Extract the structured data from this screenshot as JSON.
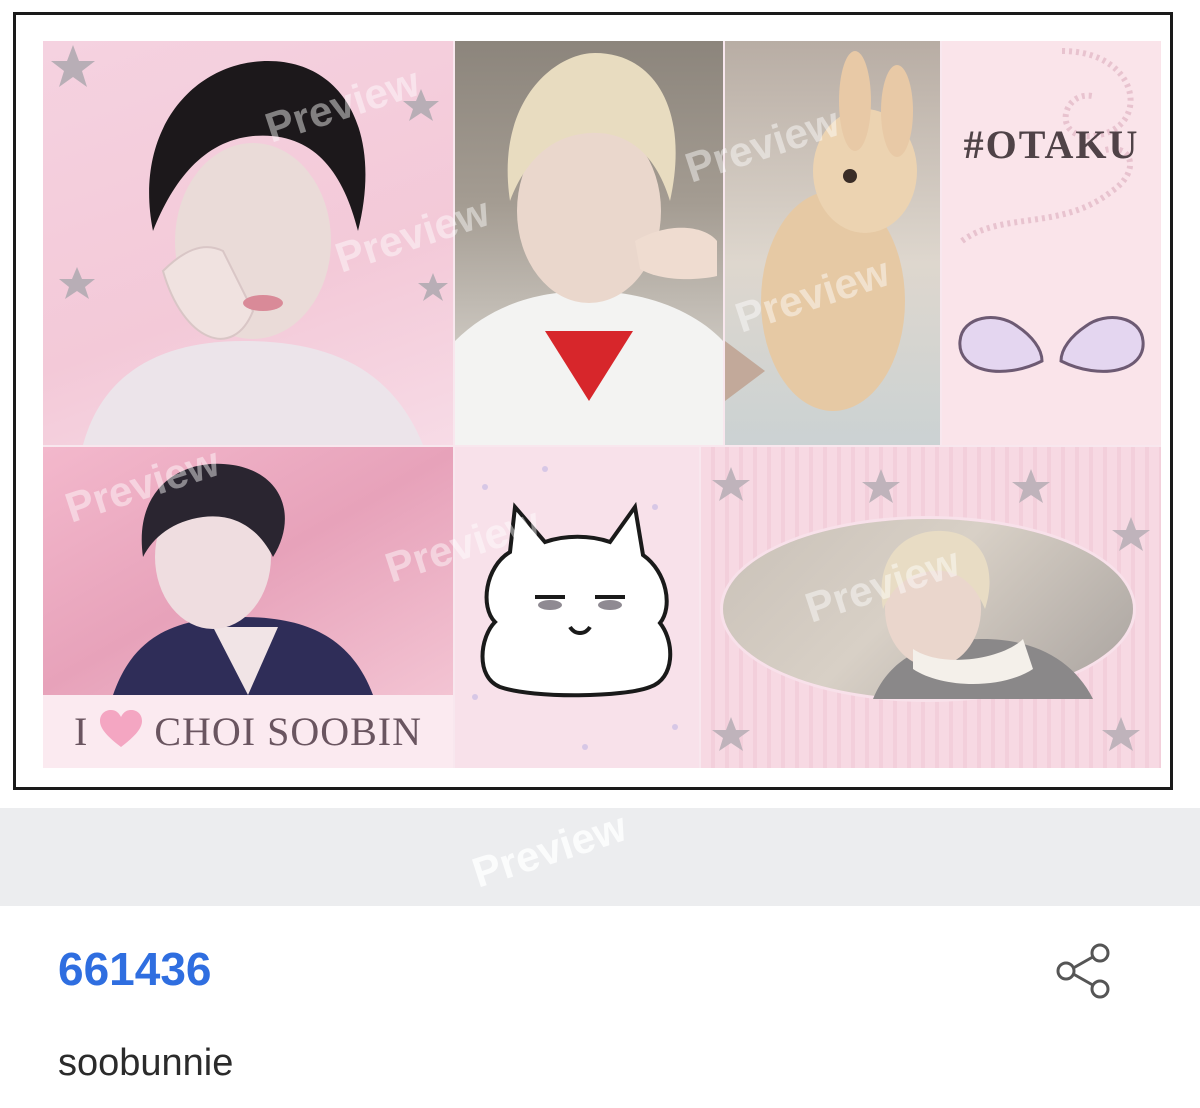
{
  "preview": {
    "watermark_text": "Preview",
    "photocard": {
      "tag_text": "#OTAKU",
      "label": {
        "prefix": "I",
        "heart_icon": "heart-icon",
        "name": "CHOI SOOBIN"
      }
    }
  },
  "post": {
    "id": "661436",
    "username": "soobunnie",
    "share_icon": "share-icon"
  },
  "colors": {
    "accent": "#2f6ee0",
    "pink_background": "#f8e7ee",
    "gray_band": "#ecedef"
  }
}
